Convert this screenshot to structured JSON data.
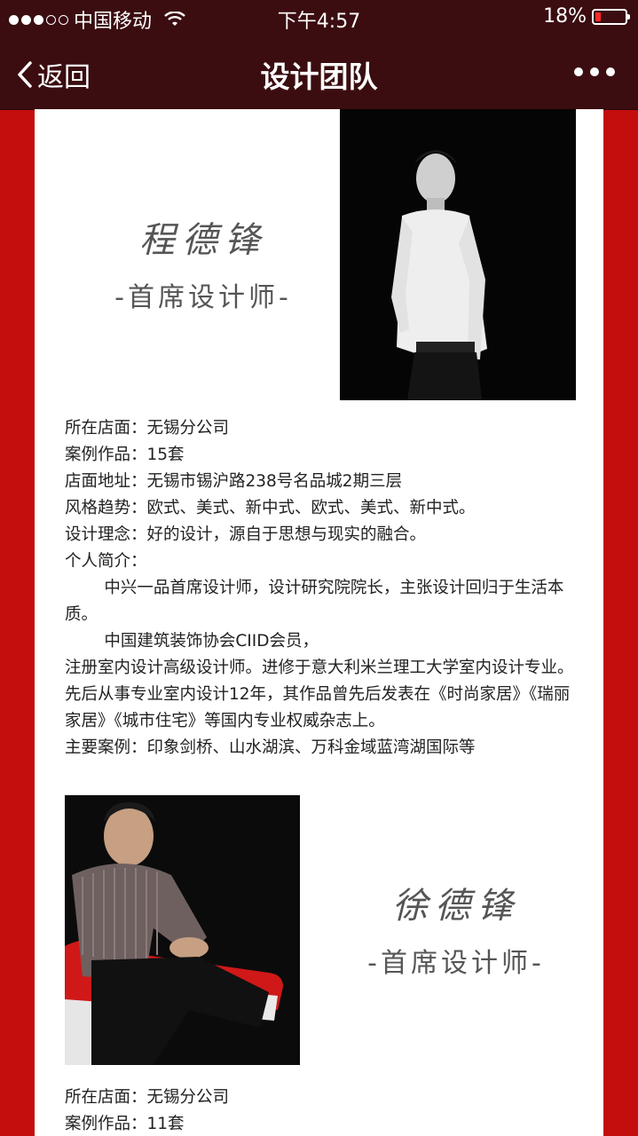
{
  "status_bar": {
    "carrier": "中国移动",
    "time": "下午4:57",
    "battery": "18%",
    "battery_level": 0.18
  },
  "nav": {
    "back_label": "返回",
    "title": "设计团队"
  },
  "designers": [
    {
      "name": "程德锋",
      "role": "-首席设计师-",
      "store": "所在店面：无锡分公司",
      "cases": "案例作品：15套",
      "address": "店面地址：无锡市锡沪路238号名品城2期三层",
      "style": "风格趋势：欧式、美式、新中式、欧式、美式、新中式。",
      "philosophy": "设计理念：好的设计，源自于思想与现实的融合。",
      "bio_label": "个人简介：",
      "bio_1": "中兴一品首席设计师，设计研究院院长，主张设计回归于生活本质。",
      "bio_2": "中国建筑装饰协会CIID会员，",
      "bio_3": "注册室内设计高级设计师。进修于意大利米兰理工大学室内设计专业。先后从事专业室内设计12年，其作品曾先后发表在《时尚家居》《瑞丽家居》《城市住宅》等国内专业权威杂志上。",
      "main_cases": "主要案例：印象剑桥、山水湖滨、万科金域蓝湾湖国际等"
    },
    {
      "name": "徐德锋",
      "role": "-首席设计师-",
      "store": "所在店面：无锡分公司",
      "cases": "案例作品：11套"
    }
  ]
}
